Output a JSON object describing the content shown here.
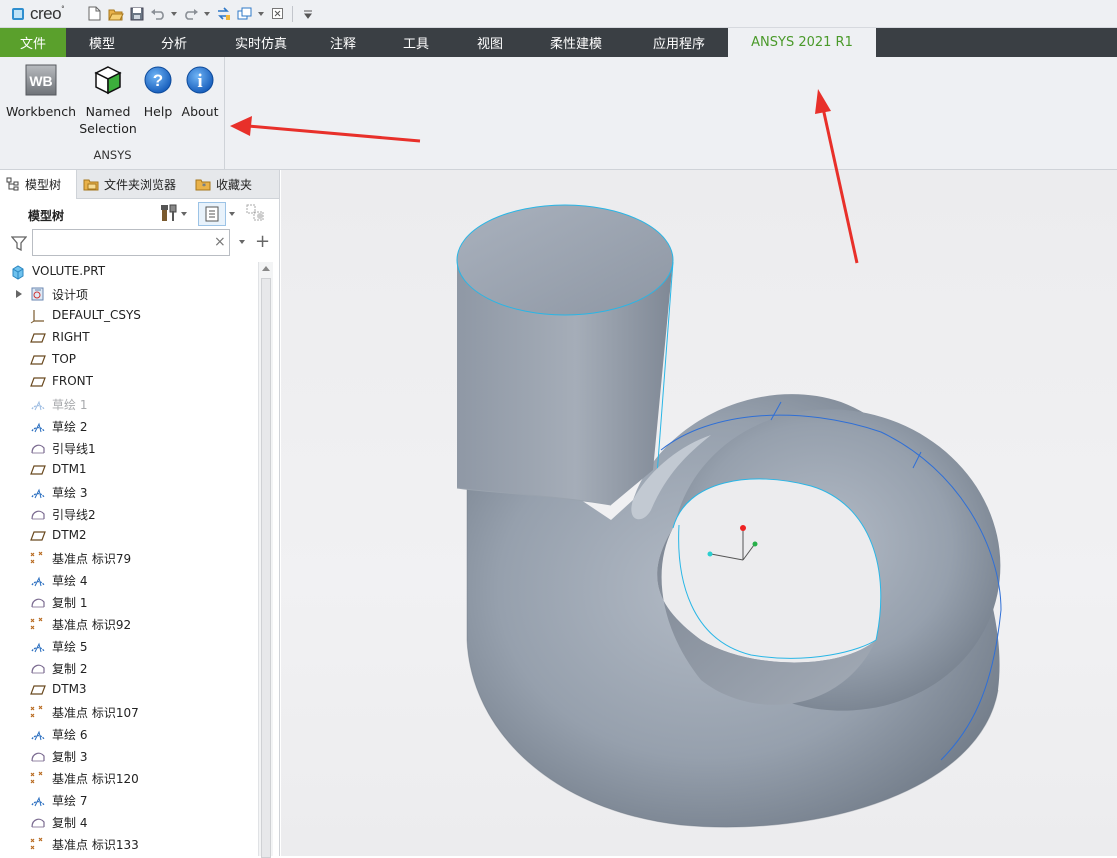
{
  "app": {
    "logo_text": "creo"
  },
  "quick_access": {
    "icons": [
      "new-icon",
      "open-icon",
      "save-icon",
      "undo-icon",
      "redo-icon",
      "regenerate-icon",
      "windows-icon",
      "close-window-icon",
      "customize-icon"
    ]
  },
  "ribbon_tabs": [
    {
      "label": "文件",
      "active": false
    },
    {
      "label": "模型",
      "active": false
    },
    {
      "label": "分析",
      "active": false
    },
    {
      "label": "实时仿真",
      "active": false
    },
    {
      "label": "注释",
      "active": false
    },
    {
      "label": "工具",
      "active": false
    },
    {
      "label": "视图",
      "active": false
    },
    {
      "label": "柔性建模",
      "active": false
    },
    {
      "label": "应用程序",
      "active": false
    },
    {
      "label": "ANSYS 2021 R1",
      "active": true
    }
  ],
  "ribbon_group": {
    "title": "ANSYS",
    "buttons": [
      {
        "label": "Workbench",
        "icon": "workbench-icon",
        "icon_text": "WB"
      },
      {
        "label_line1": "Named",
        "label_line2": "Selection",
        "icon": "named-selection-cube-icon"
      },
      {
        "label": "Help",
        "icon": "help-icon",
        "icon_text": "?"
      },
      {
        "label": "About",
        "icon": "info-icon",
        "icon_text": "i"
      }
    ]
  },
  "left_panel": {
    "tabs": [
      {
        "label": "模型树",
        "icon": "model-tree-icon",
        "active": true
      },
      {
        "label": "文件夹浏览器",
        "icon": "folder-browser-icon",
        "active": false
      },
      {
        "label": "收藏夹",
        "icon": "favorites-icon",
        "active": false
      }
    ],
    "tree_title": "模型树",
    "search": {
      "value": "",
      "placeholder": ""
    },
    "tree": [
      {
        "label": "VOLUTE.PRT",
        "icon": "part-icon",
        "root": true
      },
      {
        "label": "设计项",
        "icon": "design-items-icon",
        "expandable": true
      },
      {
        "label": "DEFAULT_CSYS",
        "icon": "csys-icon"
      },
      {
        "label": "RIGHT",
        "icon": "datum-plane-icon"
      },
      {
        "label": "TOP",
        "icon": "datum-plane-icon"
      },
      {
        "label": "FRONT",
        "icon": "datum-plane-icon"
      },
      {
        "label": "草绘 1",
        "icon": "sketch-icon",
        "dimmed": true
      },
      {
        "label": "草绘 2",
        "icon": "sketch-icon"
      },
      {
        "label": "引导线1",
        "icon": "curve-icon"
      },
      {
        "label": "DTM1",
        "icon": "datum-plane-icon"
      },
      {
        "label": "草绘 3",
        "icon": "sketch-icon"
      },
      {
        "label": "引导线2",
        "icon": "curve-icon"
      },
      {
        "label": "DTM2",
        "icon": "datum-plane-icon"
      },
      {
        "label": "基准点 标识79",
        "icon": "datum-point-icon"
      },
      {
        "label": "草绘 4",
        "icon": "sketch-icon"
      },
      {
        "label": "复制 1",
        "icon": "curve-icon"
      },
      {
        "label": "基准点 标识92",
        "icon": "datum-point-icon"
      },
      {
        "label": "草绘 5",
        "icon": "sketch-icon"
      },
      {
        "label": "复制 2",
        "icon": "curve-icon"
      },
      {
        "label": "DTM3",
        "icon": "datum-plane-icon"
      },
      {
        "label": "基准点 标识107",
        "icon": "datum-point-icon"
      },
      {
        "label": "草绘 6",
        "icon": "sketch-icon"
      },
      {
        "label": "复制 3",
        "icon": "curve-icon"
      },
      {
        "label": "基准点 标识120",
        "icon": "datum-point-icon"
      },
      {
        "label": "草绘 7",
        "icon": "sketch-icon"
      },
      {
        "label": "复制 4",
        "icon": "curve-icon"
      },
      {
        "label": "基准点 标识133",
        "icon": "datum-point-icon"
      }
    ]
  },
  "viewport": {
    "model": "volute-3d-model",
    "background": "#ededef",
    "model_color": "#8e98a6",
    "edge_color": "#29b6e6"
  },
  "colors": {
    "accent_green": "#5aa02c",
    "tab_bar": "#3a3f44",
    "annotation_arrow": "#e8302a"
  }
}
